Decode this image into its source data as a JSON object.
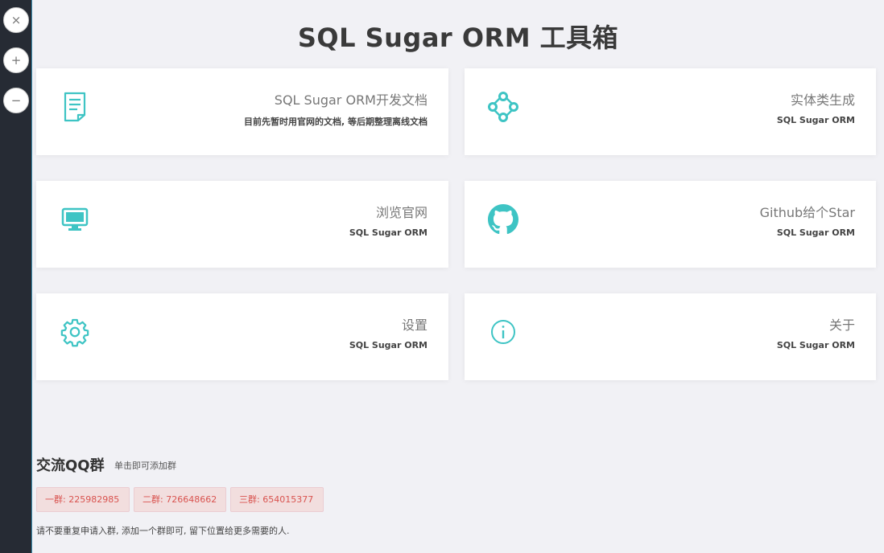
{
  "sidebar": {
    "buttons": [
      {
        "icon": "close-icon",
        "glyph": "×"
      },
      {
        "icon": "plus-icon",
        "glyph": "+"
      },
      {
        "icon": "minus-icon",
        "glyph": "−"
      }
    ]
  },
  "header": {
    "title": "SQL Sugar ORM 工具箱"
  },
  "cards": [
    {
      "title": "SQL Sugar ORM开发文档",
      "subtitle": "目前先暂时用官网的文档, 等后期整理离线文档",
      "icon": "document-icon"
    },
    {
      "title": "实体类生成",
      "subtitle": "SQL Sugar ORM",
      "icon": "nodes-icon"
    },
    {
      "title": "浏览官网",
      "subtitle": "SQL Sugar ORM",
      "icon": "monitor-icon"
    },
    {
      "title": "Github给个Star",
      "subtitle": "SQL Sugar ORM",
      "icon": "github-icon"
    },
    {
      "title": "设置",
      "subtitle": "SQL Sugar ORM",
      "icon": "gear-icon"
    },
    {
      "title": "关于",
      "subtitle": "SQL Sugar ORM",
      "icon": "info-icon"
    }
  ],
  "qq": {
    "title": "交流QQ群",
    "hint": "单击即可添加群",
    "groups": [
      {
        "label": "一群: 225982985"
      },
      {
        "label": "二群: 726648662"
      },
      {
        "label": "三群: 654015377"
      }
    ],
    "note": "请不要重复申请入群, 添加一个群即可, 留下位置给更多需要的人."
  },
  "colors": {
    "accent": "#3ec4c4",
    "sidebar": "#262b34",
    "background": "#f1f1f5",
    "tag_bg": "#f2dede",
    "tag_text": "#d9534f"
  }
}
